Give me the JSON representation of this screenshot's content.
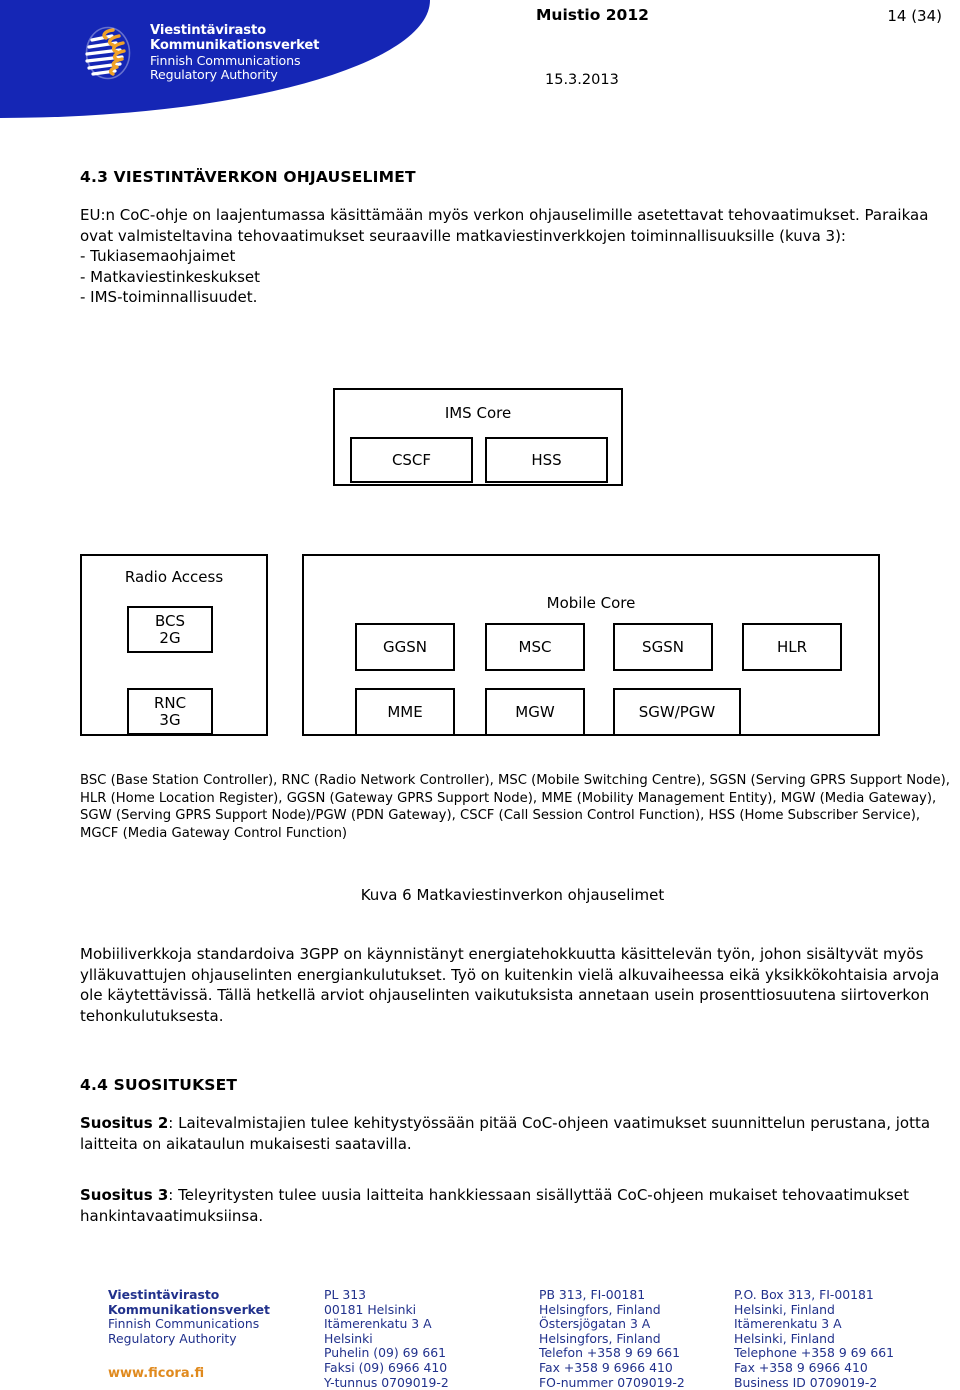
{
  "header": {
    "logo": {
      "lines": [
        {
          "text": "Viestintävirasto",
          "bold": true
        },
        {
          "text": "Kommunikationsverket",
          "bold": true
        },
        {
          "text": "Finnish Communications",
          "bold": false
        },
        {
          "text": "Regulatory Authority",
          "bold": false
        }
      ],
      "banner_color": "#1526b5",
      "accent_color": "#e08a1e"
    },
    "doc_title": "Muistio 2012",
    "page_number": "14 (34)",
    "date": "15.3.2013"
  },
  "sections": {
    "heading_43": "4.3 VIESTINTÄVERKON OHJAUSELIMET",
    "intro_paragraph": "EU:n CoC-ohje on laajentumassa käsittämään myös verkon ohjauselimille asetettavat tehovaatimukset. Paraikaa ovat valmisteltavina tehovaatimukset seuraaville matkaviestinverkkojen toiminnallisuuksille (kuva 3):\n- Tukiasemaohjaimet\n- Matkaviestinkeskukset\n- IMS-toiminnallisuudet.",
    "abbreviations": "BSC (Base Station Controller), RNC (Radio Network Controller), MSC (Mobile Switching Centre), SGSN (Serving GPRS Support Node), HLR (Home Location Register), GGSN (Gateway GPRS Support Node), MME (Mobility Management Entity), MGW (Media Gateway), SGW (Serving GPRS Support Node)/PGW (PDN Gateway), CSCF (Call Session Control Function), HSS (Home Subscriber Service), MGCF (Media Gateway Control Function)",
    "figure_caption": "Kuva 6 Matkaviestinverkon ohjauselimet",
    "paragraph_3gpp": "Mobiiliverkkoja standardoiva 3GPP on käynnistänyt energiatehokkuutta käsittelevän työn, johon sisältyvät myös ylläkuvattujen ohjauselinten energiankulutukset. Työ on kuitenkin vielä alkuvaiheessa eikä yksikkökohtaisia arvoja ole käytettävissä. Tällä hetkellä arviot ohjauselinten vaikutuksista annetaan usein prosenttiosuutena siirtoverkon tehonkulutuksesta.",
    "heading_44": "4.4 SUOSITUKSET",
    "recommendation_2_label": "Suositus 2",
    "recommendation_2_text": ": Laitevalmistajien tulee kehitystyössään pitää CoC-ohjeen vaatimukset suunnittelun perustana, jotta laitteita on aikataulun mukaisesti saatavilla.",
    "recommendation_3_label": "Suositus 3",
    "recommendation_3_text": ": Teleyritysten tulee uusia laitteita hankkiessaan sisällyttää CoC-ohjeen mukaiset tehovaatimukset hankintavaatimuksiinsa."
  },
  "diagram": {
    "groups": [
      {
        "id": "ims",
        "label": "IMS Core"
      },
      {
        "id": "radio",
        "label": "Radio Access"
      },
      {
        "id": "mobile",
        "label": "Mobile Core"
      }
    ],
    "nodes": {
      "cscf": {
        "label": "CSCF",
        "sub": ""
      },
      "hss": {
        "label": "HSS",
        "sub": ""
      },
      "bcs": {
        "label": "BCS",
        "sub": "2G"
      },
      "rnc": {
        "label": "RNC",
        "sub": "3G"
      },
      "ggsn": {
        "label": "GGSN",
        "sub": ""
      },
      "msc": {
        "label": "MSC",
        "sub": ""
      },
      "sgsn": {
        "label": "SGSN",
        "sub": ""
      },
      "hlr": {
        "label": "HLR",
        "sub": ""
      },
      "mme": {
        "label": "MME",
        "sub": ""
      },
      "mgw": {
        "label": "MGW",
        "sub": ""
      },
      "sgwpgw": {
        "label": "SGW/PGW",
        "sub": ""
      }
    }
  },
  "footer": {
    "columns": [
      {
        "lines": [
          {
            "text": "Viestintävirasto",
            "bold": true
          },
          {
            "text": "Kommunikationsverket",
            "bold": true
          },
          {
            "text": "Finnish Communications",
            "bold": false
          },
          {
            "text": "Regulatory Authority",
            "bold": false
          }
        ],
        "url": "www.ficora.fi"
      },
      {
        "lines": [
          {
            "text": "PL 313",
            "bold": false
          },
          {
            "text": "00181 Helsinki",
            "bold": false
          },
          {
            "text": "Itämerenkatu 3 A",
            "bold": false
          },
          {
            "text": "Helsinki",
            "bold": false
          },
          {
            "text": "Puhelin (09) 69 661",
            "bold": false
          },
          {
            "text": "Faksi (09) 6966 410",
            "bold": false
          },
          {
            "text": "Y-tunnus 0709019-2",
            "bold": false
          }
        ]
      },
      {
        "lines": [
          {
            "text": "PB 313, FI-00181",
            "bold": false
          },
          {
            "text": "Helsingfors, Finland",
            "bold": false
          },
          {
            "text": "Östersjögatan 3 A",
            "bold": false
          },
          {
            "text": "Helsingfors, Finland",
            "bold": false
          },
          {
            "text": "Telefon +358 9 69 661",
            "bold": false
          },
          {
            "text": "Fax +358 9 6966 410",
            "bold": false
          },
          {
            "text": "FO-nummer 0709019-2",
            "bold": false
          }
        ]
      },
      {
        "lines": [
          {
            "text": "P.O. Box 313, FI-00181",
            "bold": false
          },
          {
            "text": "Helsinki, Finland",
            "bold": false
          },
          {
            "text": "Itämerenkatu 3 A",
            "bold": false
          },
          {
            "text": "Helsinki, Finland",
            "bold": false
          },
          {
            "text": "Telephone +358 9 69 661",
            "bold": false
          },
          {
            "text": "Fax +358 9 6966 410",
            "bold": false
          },
          {
            "text": "Business ID 0709019-2",
            "bold": false
          }
        ]
      }
    ]
  }
}
